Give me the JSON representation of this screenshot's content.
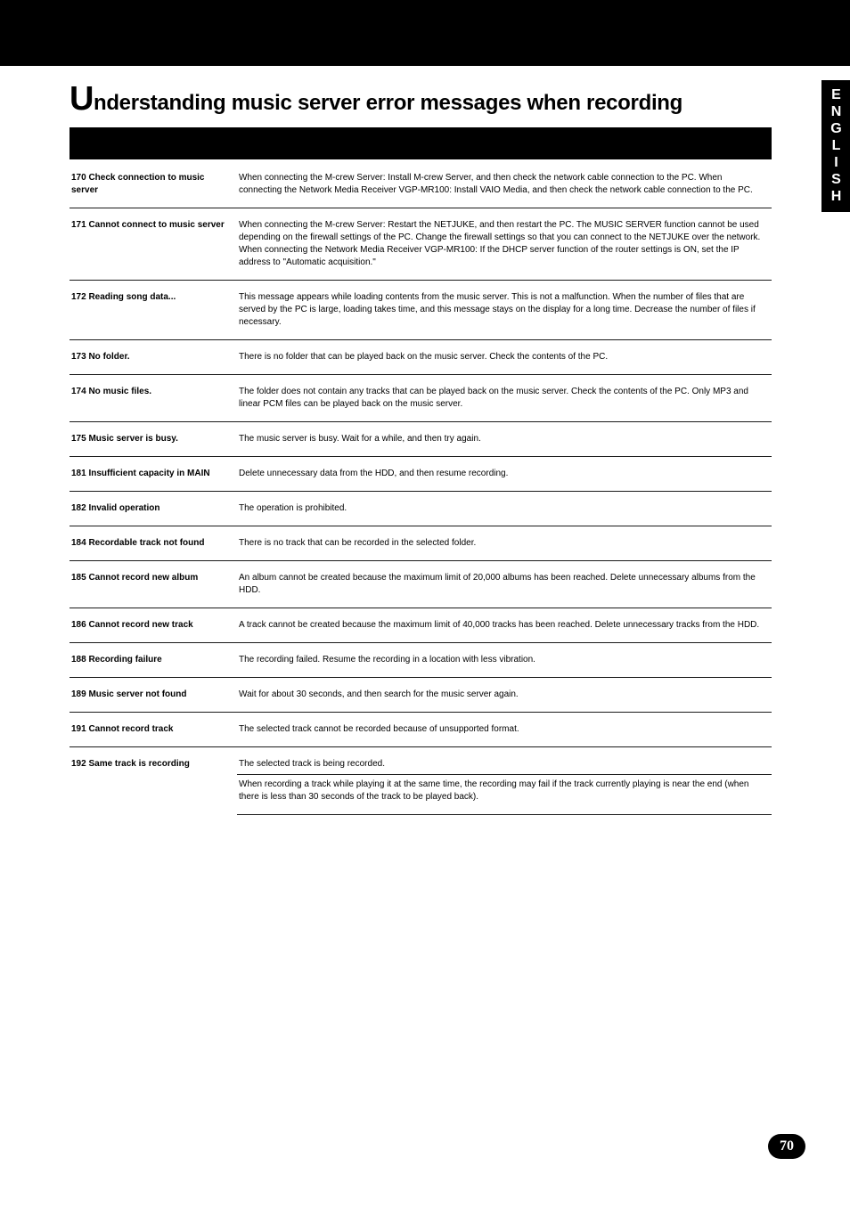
{
  "side_tab": "ENGLISH",
  "page_number": "70",
  "title_first_letter": "U",
  "title_rest": "nderstanding music server error messages when recording",
  "rows": [
    {
      "code": "170 Check connection to music server",
      "desc": "When connecting the M-crew Server: Install M-crew Server, and then check the network cable connection to the PC.\nWhen connecting the Network Media Receiver VGP-MR100: Install VAIO Media, and then check the network cable connection to the PC."
    },
    {
      "code": "171 Cannot connect to music server",
      "desc": "When connecting the M-crew Server: Restart the NETJUKE, and then restart the PC.\nThe MUSIC SERVER function cannot be used depending on the firewall settings of the PC. Change the firewall settings so that you can connect to the NETJUKE over the network.\nWhen connecting the Network Media Receiver VGP-MR100: If the DHCP server function of the router settings is ON, set the IP address to \"Automatic acquisition.\""
    },
    {
      "code": "172 Reading song data...",
      "desc": "This message appears while loading contents from the music server. This is not a malfunction.\nWhen the number of files that are served by the PC is large, loading takes time, and this message stays on the display for a long time. Decrease the number of files if necessary."
    },
    {
      "code": "173 No folder.",
      "desc": "There is no folder that can be played back on the music server. Check the contents of the PC."
    },
    {
      "code": "174 No music files.",
      "desc": "The folder does not contain any tracks that can be played back on the music server. Check the contents of the PC.\nOnly MP3 and linear PCM files can be played back on the music server."
    },
    {
      "code": "175 Music server is busy.",
      "desc": "The music server is busy. Wait for a while, and then try again."
    },
    {
      "code": "181 Insufficient capacity in MAIN",
      "desc": "Delete unnecessary data from the HDD, and then resume recording."
    },
    {
      "code": "182 Invalid operation",
      "desc": "The operation is prohibited."
    },
    {
      "code": "184 Recordable track not found",
      "desc": "There is no track that can be recorded in the selected folder."
    },
    {
      "code": "185 Cannot record new album",
      "desc": "An album cannot be created because the maximum limit of 20,000 albums has been reached. Delete unnecessary albums from the HDD."
    },
    {
      "code": "186 Cannot record new track",
      "desc": "A track cannot be created because the maximum limit of 40,000 tracks has been reached. Delete unnecessary tracks from the HDD."
    },
    {
      "code": "188 Recording failure",
      "desc": "The recording failed. Resume the recording in a location with less vibration."
    },
    {
      "code": "189 Music server not found",
      "desc": "Wait for about 30 seconds, and then search for the music server again."
    },
    {
      "code": "191 Cannot record track",
      "desc": "The selected track cannot be recorded because of unsupported format."
    },
    {
      "code": "192 Same track is recording",
      "nested": [
        {
          "desc": "The selected track is being recorded."
        },
        {
          "desc": "When recording a track while playing it at the same time, the recording may fail if the track currently playing is near the end (when there is less than 30 seconds of the track to be played back)."
        }
      ]
    }
  ]
}
